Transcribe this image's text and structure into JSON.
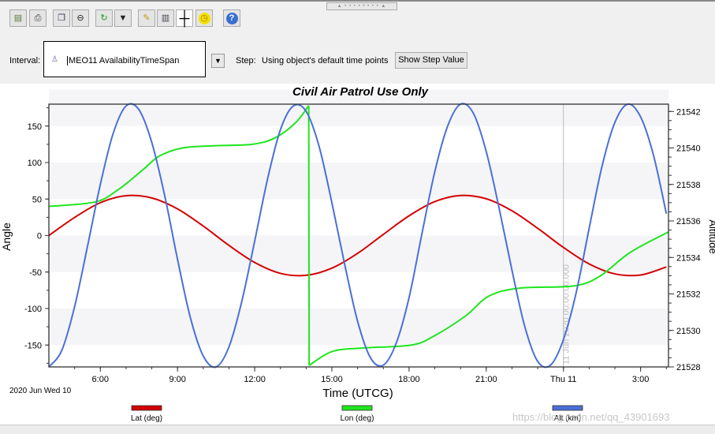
{
  "toolbar": {
    "buttons": [
      {
        "icon": "save-icon"
      },
      {
        "icon": "print-icon"
      },
      {
        "icon": "copy-icon"
      },
      {
        "icon": "zoom-out-icon"
      },
      {
        "icon": "refresh-icon"
      },
      {
        "icon": "report-options-icon"
      },
      {
        "icon": "properties-icon"
      },
      {
        "icon": "save-data-icon"
      },
      {
        "icon": "crosshair-icon"
      },
      {
        "icon": "animation-time-icon"
      },
      {
        "icon": "help-icon"
      }
    ]
  },
  "interval": {
    "label": "Interval:",
    "value": "MEO11 AvailabilityTimeSpan"
  },
  "step": {
    "label": "Step:",
    "value": "Using object's default time points",
    "button": "Show Step Value"
  },
  "chart_data": {
    "type": "line",
    "title": "Civil Air Patrol Use Only",
    "xlabel": "Time (UTCG)",
    "x_start_label": "2020 Jun Wed 10",
    "ylabel": "Angle",
    "y2label": "Altitude",
    "xlim": [
      "2020-06-10T04:00",
      "2020-06-11T04:05"
    ],
    "ylim": [
      -180,
      180
    ],
    "y2lim": [
      21528,
      21542.4
    ],
    "xticks": [
      {
        "t": "2020-06-10T06:00",
        "label": "6:00"
      },
      {
        "t": "2020-06-10T09:00",
        "label": "9:00"
      },
      {
        "t": "2020-06-10T12:00",
        "label": "12:00"
      },
      {
        "t": "2020-06-10T15:00",
        "label": "15:00"
      },
      {
        "t": "2020-06-10T18:00",
        "label": "18:00"
      },
      {
        "t": "2020-06-10T21:00",
        "label": "21:00"
      },
      {
        "t": "2020-06-11T00:00",
        "label": "Thu 11"
      },
      {
        "t": "2020-06-11T03:00",
        "label": "3:00"
      }
    ],
    "yticks": [
      -150,
      -100,
      -50,
      0,
      50,
      100,
      150
    ],
    "y2ticks": [
      21528,
      21530,
      21532,
      21534,
      21536,
      21538,
      21540,
      21542
    ],
    "marker_line": {
      "t": "2020-06-11T00:00",
      "label": "11 Jun 2020 00:00:00.000"
    },
    "grid": "horizontal bands",
    "legend_position": "bottom",
    "series": [
      {
        "name": "Lat (deg)",
        "axis": "left",
        "color": "#d40000",
        "start": "2020-06-10T04:00",
        "step_hours": 1,
        "values": [
          0,
          24.8,
          45,
          54.6,
          51.5,
          36.5,
          13,
          -13.5,
          -36.9,
          -51.8,
          -54.5,
          -44.7,
          -24.4,
          1.6,
          27,
          46.5,
          54.9,
          50.4,
          33.9,
          9.9,
          -16.3,
          -38.9,
          -52.5,
          -54,
          -43
        ]
      },
      {
        "name": "Lon (deg)",
        "axis": "left",
        "color": "#1ee61e",
        "points": [
          [
            "2020-06-10T04:00",
            40
          ],
          [
            "2020-06-10T05:48",
            46
          ],
          [
            "2020-06-10T06:42",
            63
          ],
          [
            "2020-06-10T07:39",
            90
          ],
          [
            "2020-06-10T08:18",
            109
          ],
          [
            "2020-06-10T09:12",
            120
          ],
          [
            "2020-06-10T10:24",
            123
          ],
          [
            "2020-06-10T11:54",
            125
          ],
          [
            "2020-06-10T12:48",
            134
          ],
          [
            "2020-06-10T13:36",
            155
          ],
          [
            "2020-06-10T14:06",
            178
          ],
          null,
          [
            "2020-06-10T14:07",
            -178
          ],
          [
            "2020-06-10T15:00",
            -159
          ],
          [
            "2020-06-10T16:12",
            -154
          ],
          [
            "2020-06-10T18:06",
            -150
          ],
          [
            "2020-06-10T19:00",
            -137
          ],
          [
            "2020-06-10T20:12",
            -110
          ],
          [
            "2020-06-10T21:06",
            -83
          ],
          [
            "2020-06-10T22:18",
            -72
          ],
          [
            "2020-06-11T00:24",
            -69
          ],
          [
            "2020-06-11T01:24",
            -56
          ],
          [
            "2020-06-11T02:36",
            -23
          ],
          [
            "2020-06-11T04:05",
            5
          ]
        ]
      },
      {
        "name": "Alt (km)",
        "axis": "right",
        "color": "#4a6fd8",
        "start": "2020-06-10T04:00",
        "step_hours": 0.5,
        "values": [
          21528.0,
          21528.9,
          21531.3,
          21534.6,
          21538.0,
          21540.8,
          21542.3,
          21542.1,
          21540.3,
          21537.4,
          21533.9,
          21530.7,
          21528.6,
          21528.0,
          21529.1,
          21531.6,
          21534.9,
          21538.3,
          21541.0,
          21542.3,
          21542.0,
          21540.1,
          21537.0,
          21533.6,
          21530.5,
          21528.5,
          21528.1,
          21529.3,
          21531.8,
          21535.3,
          21538.7,
          21541.2,
          21542.4,
          21541.9,
          21539.8,
          21536.7,
          21533.3,
          21530.2,
          21528.3,
          21528.1,
          21529.5,
          21532.1,
          21535.6,
          21539.0,
          21541.4,
          21542.4,
          21541.7,
          21539.6,
          21536.4
        ]
      }
    ]
  },
  "watermark": "https://blog.csdn.net/qq_43901693"
}
